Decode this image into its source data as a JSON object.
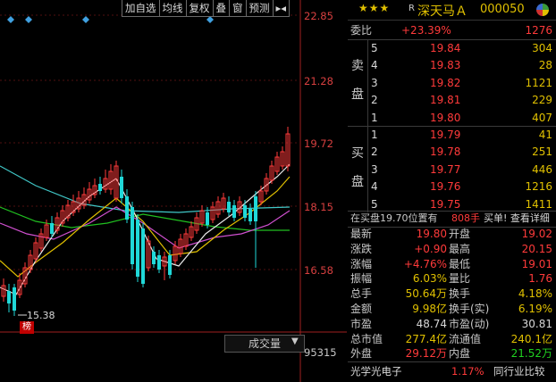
{
  "toolbar": {
    "add_watch": "加自选",
    "ma_line": "均线",
    "adjust": "复权",
    "overlay": "叠",
    "window": "窗",
    "forecast": "预测",
    "arrow": "▸◂"
  },
  "y_axis": {
    "price_ticks": [
      "22.85",
      "21.28",
      "19.72",
      "18.15",
      "16.58"
    ],
    "volume_tick": "95315"
  },
  "low_label": "15.38",
  "bang_badge": "榜",
  "volume_button": "成交量",
  "stock": {
    "stars": "★★★",
    "r_mark": "R",
    "name": "深天马Ａ",
    "code": "000050"
  },
  "order_book": {
    "weibi_label": "委比",
    "weibi_value": "+23.39%",
    "weicha_value": "1276",
    "sell_label": [
      "卖",
      "盘"
    ],
    "buy_label": [
      "买",
      "盘"
    ],
    "sell": [
      {
        "level": "5",
        "price": "19.84",
        "volume": "304"
      },
      {
        "level": "4",
        "price": "19.83",
        "volume": "28"
      },
      {
        "level": "3",
        "price": "19.82",
        "volume": "1121"
      },
      {
        "level": "2",
        "price": "19.81",
        "volume": "229"
      },
      {
        "level": "1",
        "price": "19.80",
        "volume": "407"
      }
    ],
    "buy": [
      {
        "level": "1",
        "price": "19.79",
        "volume": "41"
      },
      {
        "level": "2",
        "price": "19.78",
        "volume": "251"
      },
      {
        "level": "3",
        "price": "19.77",
        "volume": "446"
      },
      {
        "level": "4",
        "price": "19.76",
        "volume": "1216"
      },
      {
        "level": "5",
        "price": "19.75",
        "volume": "1411"
      }
    ]
  },
  "position_bar": {
    "text": "在买盘19.70位置有",
    "qty": "808手",
    "action": "买单! 查看详细"
  },
  "stats": [
    {
      "l1": "最新",
      "v1": "19.80",
      "c1": "red",
      "l2": "开盘",
      "v2": "19.02",
      "c2": "red"
    },
    {
      "l1": "涨跌",
      "v1": "+0.90",
      "c1": "red",
      "l2": "最高",
      "v2": "20.15",
      "c2": "red"
    },
    {
      "l1": "涨幅",
      "v1": "+4.76%",
      "c1": "red",
      "l2": "最低",
      "v2": "19.01",
      "c2": "red"
    },
    {
      "l1": "振幅",
      "v1": "6.03%",
      "c1": "yellow",
      "l2": "量比",
      "v2": "1.76",
      "c2": "red"
    },
    {
      "l1": "总手",
      "v1": "50.64万",
      "c1": "yellow",
      "l2": "换手",
      "v2": "4.18%",
      "c2": "yellow"
    },
    {
      "l1": "金额",
      "v1": "9.98亿",
      "c1": "yellow",
      "l2": "换手(实)",
      "v2": "6.19%",
      "c2": "yellow"
    },
    {
      "l1": "市盈",
      "v1": "48.74",
      "c1": "white",
      "l2": "市盈(动)",
      "v2": "30.81",
      "c2": "white"
    },
    {
      "l1": "总市值",
      "v1": "277.4亿",
      "c1": "yellow",
      "l2": "流通值",
      "v2": "240.1亿",
      "c2": "yellow"
    },
    {
      "l1": "外盘",
      "v1": "29.12万",
      "c1": "red",
      "l2": "内盘",
      "v2": "21.52万",
      "c2": "green"
    }
  ],
  "industry": {
    "name": "光学光电子",
    "change": "1.17%",
    "rank_button": "同行业比较"
  },
  "colors": {
    "up": "#ff3a3a",
    "down": "#20d8d8",
    "ma5": "#e8e8e8",
    "ma10": "#e0c000",
    "ma20": "#d050d0",
    "ma30": "#20c020",
    "ma60": "#40c8c8"
  }
}
